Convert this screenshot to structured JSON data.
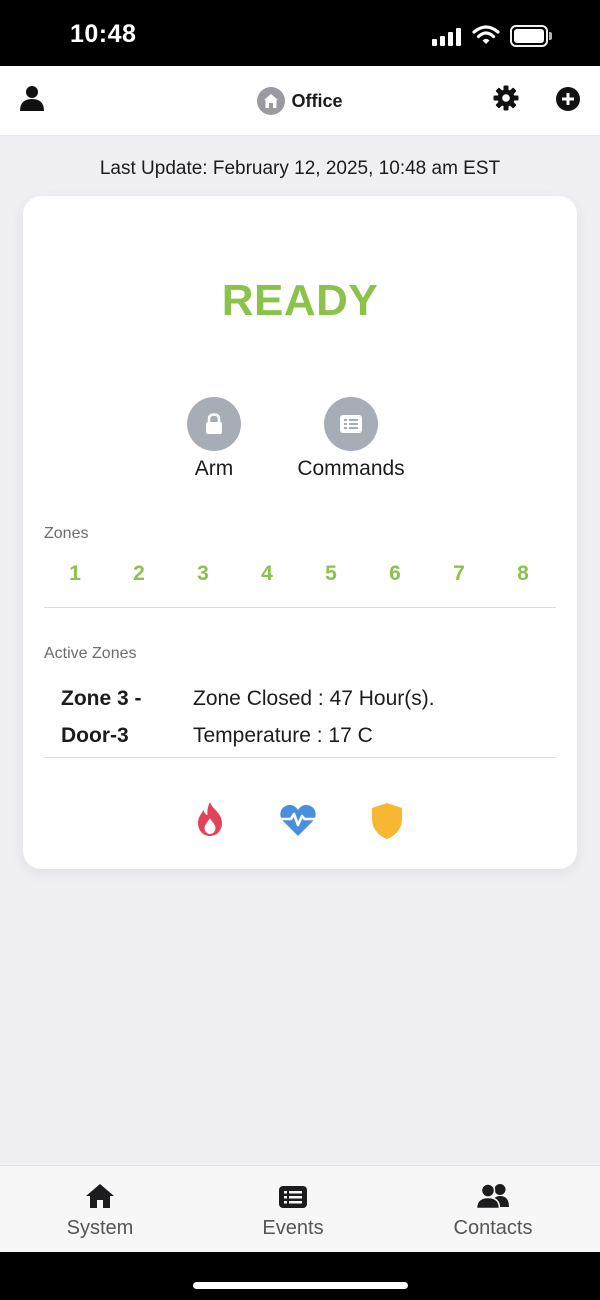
{
  "status_bar": {
    "time": "10:48"
  },
  "header": {
    "title": "Office"
  },
  "last_update": "Last Update: February 12, 2025, 10:48 am EST",
  "panel": {
    "status": "READY",
    "status_color": "#8bc34a",
    "actions": [
      {
        "label": "Arm",
        "icon": "lock-icon"
      },
      {
        "label": "Commands",
        "icon": "list-icon"
      }
    ],
    "zones_label": "Zones",
    "zones": [
      "1",
      "2",
      "3",
      "4",
      "5",
      "6",
      "7",
      "8"
    ],
    "active_zones_label": "Active Zones",
    "active_zone": {
      "name_line1": "Zone 3 -",
      "name_line2": "Door-3",
      "info_line1": "Zone Closed : 47 Hour(s).",
      "info_line2": "Temperature : 17 C"
    },
    "indicators": [
      {
        "icon": "fire-icon",
        "color": "#e0435a"
      },
      {
        "icon": "heart-pulse-icon",
        "color": "#4a8fdb"
      },
      {
        "icon": "shield-icon",
        "color": "#f7b733"
      }
    ]
  },
  "nav": [
    {
      "label": "System",
      "icon": "home-icon"
    },
    {
      "label": "Events",
      "icon": "list-icon"
    },
    {
      "label": "Contacts",
      "icon": "users-icon"
    }
  ]
}
